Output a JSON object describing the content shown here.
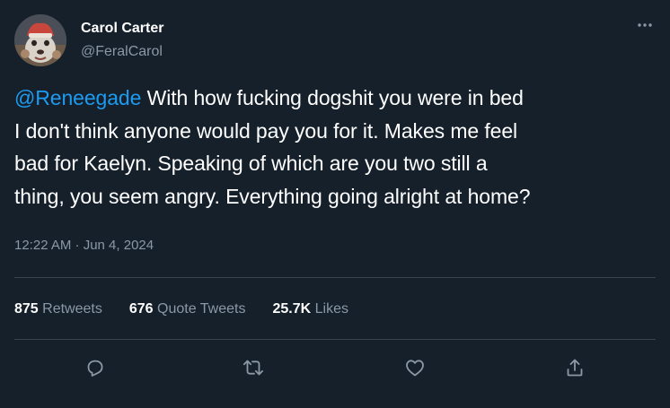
{
  "author": {
    "display_name": "Carol Carter",
    "handle": "@FeralCarol"
  },
  "tweet": {
    "mention": "@Reneegade",
    "text_lines": [
      " With how fucking dogshit you were in bed",
      "I don't think anyone would pay you for it. Makes me feel",
      "bad for Kaelyn. Speaking of which are you two still a",
      "thing, you seem angry. Everything going alright at home?"
    ],
    "timestamp": "12:22 AM · Jun 4, 2024"
  },
  "stats": {
    "retweets_count": "875",
    "retweets_label": "Retweets",
    "quotes_count": "676",
    "quotes_label": "Quote Tweets",
    "likes_count": "25.7K",
    "likes_label": "Likes"
  },
  "icons": {
    "more": "more-horizontal-icon",
    "reply": "reply-icon",
    "retweet": "retweet-icon",
    "like": "heart-icon",
    "share": "share-icon"
  },
  "colors": {
    "background": "#15202b",
    "text_primary": "#ffffff",
    "text_secondary": "#8b98a5",
    "accent": "#1d9bf0",
    "divider": "#38444d"
  }
}
